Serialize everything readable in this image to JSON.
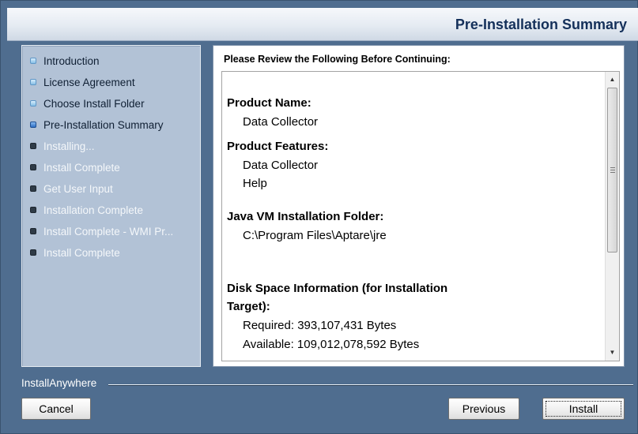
{
  "header": {
    "title": "Pre-Installation Summary"
  },
  "steps": [
    {
      "label": "Introduction",
      "state": "done"
    },
    {
      "label": "License Agreement",
      "state": "done"
    },
    {
      "label": "Choose Install Folder",
      "state": "done"
    },
    {
      "label": "Pre-Installation Summary",
      "state": "current"
    },
    {
      "label": "Installing...",
      "state": "todo"
    },
    {
      "label": "Install Complete",
      "state": "todo"
    },
    {
      "label": "Get User Input",
      "state": "todo"
    },
    {
      "label": "Installation Complete",
      "state": "todo"
    },
    {
      "label": "Install Complete - WMI Pr...",
      "state": "todo"
    },
    {
      "label": "Install Complete",
      "state": "todo"
    }
  ],
  "content": {
    "heading": "Please Review the Following Before Continuing:",
    "product_name_title": "Product Name:",
    "product_name_value": "Data Collector",
    "product_features_title": "Product Features:",
    "product_features": [
      "Data Collector",
      "Help"
    ],
    "jvm_title": "Java VM Installation Folder:",
    "jvm_value": "C:\\Program Files\\Aptare\\jre",
    "disk_title_line1": "Disk Space Information (for Installation",
    "disk_title_line2": "Target):",
    "disk_required": "Required: 393,107,431 Bytes",
    "disk_available": "Available: 109,012,078,592 Bytes"
  },
  "scrollbar": {
    "up_icon": "▲",
    "down_icon": "▼"
  },
  "footer": {
    "brand": "InstallAnywhere",
    "cancel_label": "Cancel",
    "previous_label": "Previous",
    "install_label": "Install"
  },
  "colors": {
    "frame": "#4f6d8f",
    "steps_panel": "#b2c2d6",
    "title_text": "#14305a"
  }
}
